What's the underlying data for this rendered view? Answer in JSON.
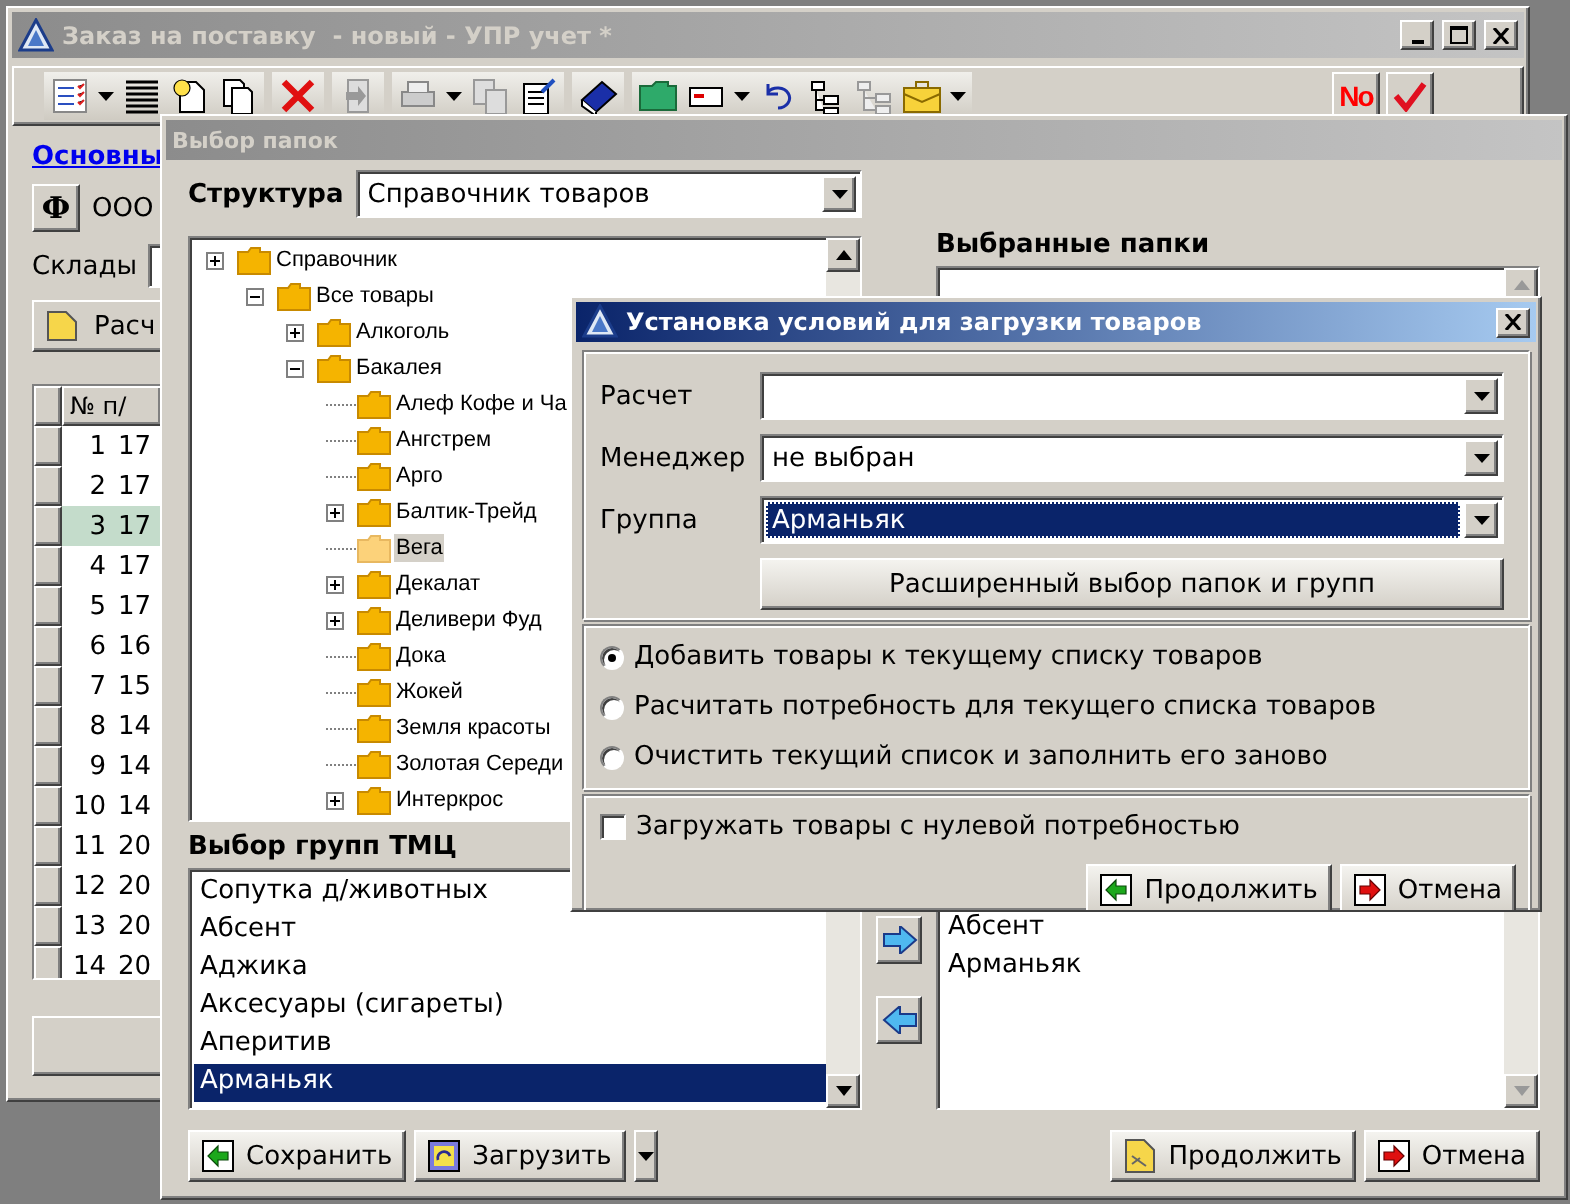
{
  "main_window": {
    "title": "Заказ на поставку  - новый - УПР учет *",
    "number_button": "No",
    "tab_link": "Основны",
    "org_button": "Ф",
    "org_name": "ООО",
    "warehouse_label": "Склады",
    "calc_button": "Расч",
    "table": {
      "columns": [
        "№ п/"
      ],
      "rows": [
        {
          "cells": [
            "1",
            "17"
          ],
          "selected": false
        },
        {
          "cells": [
            "2",
            "17"
          ],
          "selected": false
        },
        {
          "cells": [
            "3",
            "17"
          ],
          "selected": true
        },
        {
          "cells": [
            "4",
            "17"
          ],
          "selected": false
        },
        {
          "cells": [
            "5",
            "17"
          ],
          "selected": false
        },
        {
          "cells": [
            "6",
            "16"
          ],
          "selected": false
        },
        {
          "cells": [
            "7",
            "15"
          ],
          "selected": false
        },
        {
          "cells": [
            "8",
            "14"
          ],
          "selected": false
        },
        {
          "cells": [
            "9",
            "14"
          ],
          "selected": false
        },
        {
          "cells": [
            "10",
            "14"
          ],
          "selected": false
        },
        {
          "cells": [
            "11",
            "20"
          ],
          "selected": false
        },
        {
          "cells": [
            "12",
            "20"
          ],
          "selected": false
        },
        {
          "cells": [
            "13",
            "20"
          ],
          "selected": false
        },
        {
          "cells": [
            "14",
            "20"
          ],
          "selected": false
        }
      ]
    }
  },
  "folder_window": {
    "title": "Выбор папок",
    "structure_label": "Структура",
    "structure_value": "Справочник товаров",
    "tree": [
      {
        "label": "Справочник",
        "expanded": false,
        "selected": false,
        "children": [
          {
            "label": "Все товары",
            "expanded": true,
            "selected": false,
            "children": [
              {
                "label": "Алкоголь",
                "expanded": false,
                "selected": false
              },
              {
                "label": "Бакалея",
                "expanded": true,
                "selected": false,
                "children": [
                  {
                    "label": "Алеф Кофе и Ча",
                    "selected": false
                  },
                  {
                    "label": "Ангстрем",
                    "selected": false
                  },
                  {
                    "label": "Арго",
                    "selected": false
                  },
                  {
                    "label": "Балтик-Трейд",
                    "expanded": false,
                    "selected": false
                  },
                  {
                    "label": "Вега",
                    "selected": true
                  },
                  {
                    "label": "Декалат",
                    "expanded": false,
                    "selected": false
                  },
                  {
                    "label": "Деливери Фуд",
                    "expanded": false,
                    "selected": false
                  },
                  {
                    "label": "Дока",
                    "selected": false
                  },
                  {
                    "label": "Жокей",
                    "selected": false
                  },
                  {
                    "label": "Земля красоты",
                    "selected": false
                  },
                  {
                    "label": "Золотая Середи",
                    "selected": false
                  },
                  {
                    "label": "Интеркрос",
                    "expanded": false,
                    "selected": false
                  }
                ]
              }
            ]
          }
        ]
      }
    ],
    "selected_label": "Выбранные папки",
    "selected_items": [
      "Абсент",
      "Арманьяк"
    ],
    "groups_label": "Выбор групп ТМЦ",
    "groups": [
      {
        "label": "Сопутка д/животных",
        "selected": false
      },
      {
        "label": "Абсент",
        "selected": false
      },
      {
        "label": "Аджика",
        "selected": false
      },
      {
        "label": "Аксесуары (сигареты)",
        "selected": false
      },
      {
        "label": "Аперитив",
        "selected": false
      },
      {
        "label": "Арманьяк",
        "selected": true
      }
    ],
    "left_buttons": [
      {
        "label": "Сохранить",
        "kind": "save"
      },
      {
        "label": "Загрузить",
        "kind": "load",
        "dropdown": true
      }
    ],
    "right_buttons": [
      {
        "label": "Продолжить",
        "kind": "continue"
      },
      {
        "label": "Отмена",
        "kind": "cancel"
      }
    ]
  },
  "dialog": {
    "title": "Установка условий для загрузки товаров",
    "fields": [
      {
        "label": "Расчет",
        "focused": false
      },
      {
        "label": "Менеджер",
        "value": "не выбран",
        "focused": false
      },
      {
        "label": "Группа",
        "value": "Арманьяк",
        "focused": true
      }
    ],
    "wide_button": "Расширенный выбор папок и групп",
    "options": [
      {
        "label": "Добавить товары к текущему списку товаров",
        "selected": true
      },
      {
        "label": "Расчитать потребность для текущего списка товаров",
        "selected": false
      },
      {
        "label": "Очистить текущий список и заполнить его заново",
        "selected": false
      }
    ],
    "zero_need": {
      "label": "Загружать товары с нулевой потребностью",
      "checked": false
    },
    "buttons": [
      {
        "label": "Продолжить",
        "kind": "confirm"
      },
      {
        "label": "Отмена",
        "kind": "cancel"
      }
    ]
  }
}
